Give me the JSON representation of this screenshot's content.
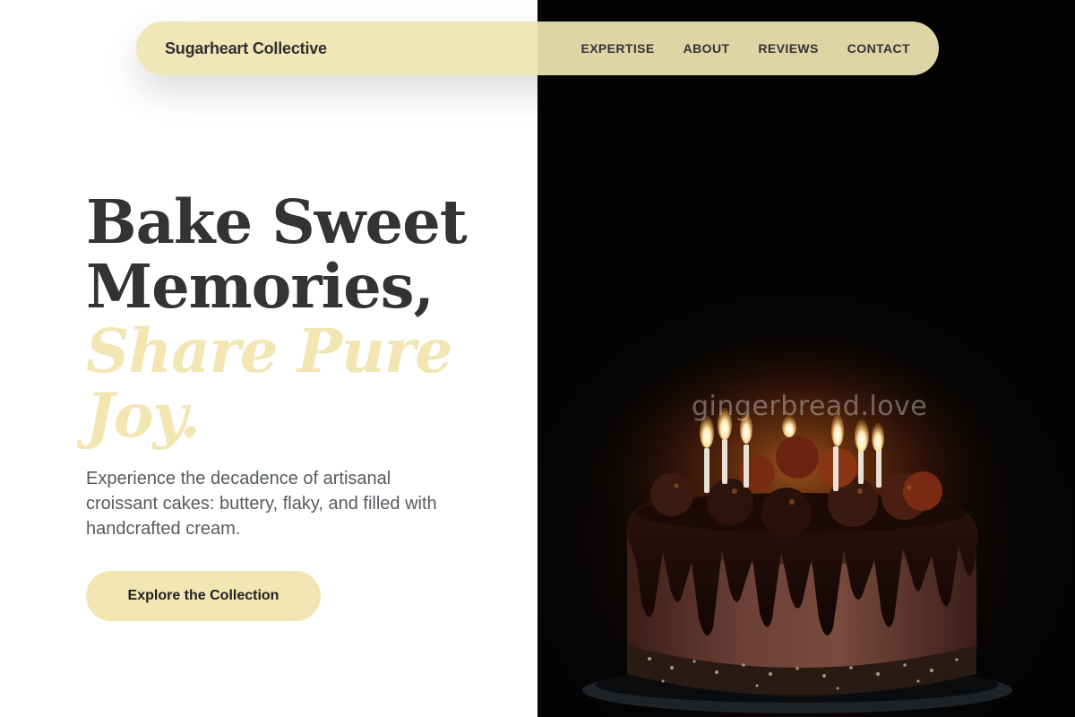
{
  "header": {
    "brand": "Sugarheart Collective",
    "nav": [
      {
        "label": "EXPERTISE"
      },
      {
        "label": "ABOUT"
      },
      {
        "label": "REVIEWS"
      },
      {
        "label": "CONTACT"
      }
    ]
  },
  "hero": {
    "title_line1": "Bake Sweet",
    "title_line2": "Memories,",
    "title_accent_line1": "Share Pure",
    "title_accent_line2": "Joy.",
    "description": "Experience the decadence of artisanal croissant cakes: buttery, flaky, and filled with handcrafted cream.",
    "cta_label": "Explore the Collection"
  },
  "image": {
    "watermark": "gingerbread.love"
  },
  "colors": {
    "accent": "#f2e6b3",
    "heading": "#333333",
    "body_text": "#555b60",
    "photo_background": "#050404"
  }
}
